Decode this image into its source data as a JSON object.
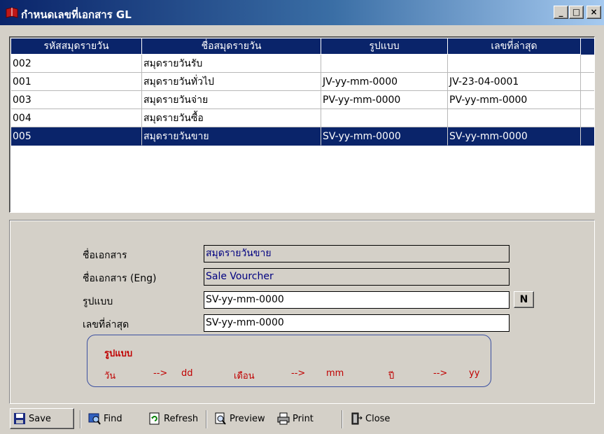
{
  "window": {
    "title": "กำหนดเลขที่เอกสาร GL",
    "minimize_glyph": "_",
    "maximize_glyph": "□",
    "close_glyph": "×"
  },
  "grid": {
    "columns": [
      "รหัสสมุดรายวัน",
      "ชื่อสมุดรายวัน",
      "รูปแบบ",
      "เลขที่ล่าสุด"
    ],
    "rows": [
      {
        "code": "002",
        "name": "สมุดรายวันรับ",
        "format": "",
        "last_no": ""
      },
      {
        "code": "001",
        "name": "สมุดรายวันทั่วไป",
        "format": "JV-yy-mm-0000",
        "last_no": "JV-23-04-0001"
      },
      {
        "code": "003",
        "name": "สมุดรายวันจ่าย",
        "format": "PV-yy-mm-0000",
        "last_no": "PV-yy-mm-0000"
      },
      {
        "code": "004",
        "name": "สมุดรายวันซื้อ",
        "format": "",
        "last_no": ""
      },
      {
        "code": "005",
        "name": "สมุดรายวันขาย",
        "format": "SV-yy-mm-0000",
        "last_no": "SV-yy-mm-0000"
      }
    ],
    "selected_row": 4
  },
  "form": {
    "doc_name_label": "ชื่อเอกสาร",
    "doc_name_value": "สมุดรายวันขาย",
    "doc_name_eng_label": "ชื่อเอกสาร (Eng)",
    "doc_name_eng_value": "Sale Vourcher",
    "format_label": "รูปแบบ",
    "format_value": "SV-yy-mm-0000",
    "n_button": "N",
    "last_no_label": "เลขที่ล่าสุด",
    "last_no_value": "SV-yy-mm-0000"
  },
  "legend": {
    "title": "รูปแบบ",
    "day_label": "วัน",
    "arrow1": "-->",
    "day_code": "dd",
    "month_label": "เดือน",
    "arrow2": "-->",
    "month_code": "mm",
    "year_label": "ปี",
    "arrow3": "-->",
    "year_code": "yy"
  },
  "toolbar": {
    "save": "Save",
    "find": "Find",
    "refresh": "Refresh",
    "preview": "Preview",
    "print": "Print",
    "close": "Close"
  },
  "colors": {
    "selection": "#0a246a",
    "window_bg": "#d4d0c8",
    "legend_text": "#c00000"
  }
}
